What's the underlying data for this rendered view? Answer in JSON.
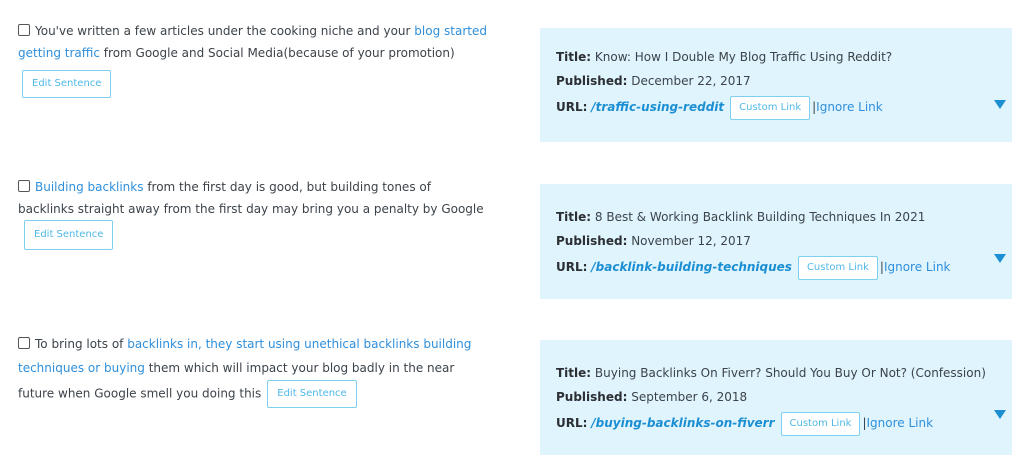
{
  "edit_label": "Edit Sentence",
  "custom_link_label": "Custom Link",
  "ignore_link_label": "Ignore Link",
  "labels": {
    "title": "Title:",
    "published": "Published:",
    "url": "URL:",
    "separator": "|"
  },
  "items": [
    {
      "sentence_pre": "You've written a few articles under the cooking niche and your ",
      "sentence_link": "blog started getting traffic",
      "sentence_post": " from Google and Social Media(because of your promotion)",
      "card_title": "Know: How I Double My Blog Traffic Using Reddit?",
      "card_published": "December 22, 2017",
      "card_url": "/traffic-using-reddit"
    },
    {
      "sentence_pre": "",
      "sentence_link": "Building backlinks",
      "sentence_post": " from the first day is good, but building tones of backlinks straight away from the first day may bring you a penalty by Google",
      "card_title": "8 Best & Working Backlink Building Techniques In 2021",
      "card_published": "November 12, 2017",
      "card_url": "/backlink-building-techniques"
    },
    {
      "sentence_pre": "To bring lots of ",
      "sentence_link": "backlinks in, they start using unethical backlinks building techniques or buying",
      "sentence_post": " them which will impact your blog badly in the near future when Google smell you doing this",
      "card_title": "Buying Backlinks On Fiverr? Should You Buy Or Not? (Confession)",
      "card_published": "September 6, 2018",
      "card_url": "/buying-backlinks-on-fiverr"
    }
  ]
}
